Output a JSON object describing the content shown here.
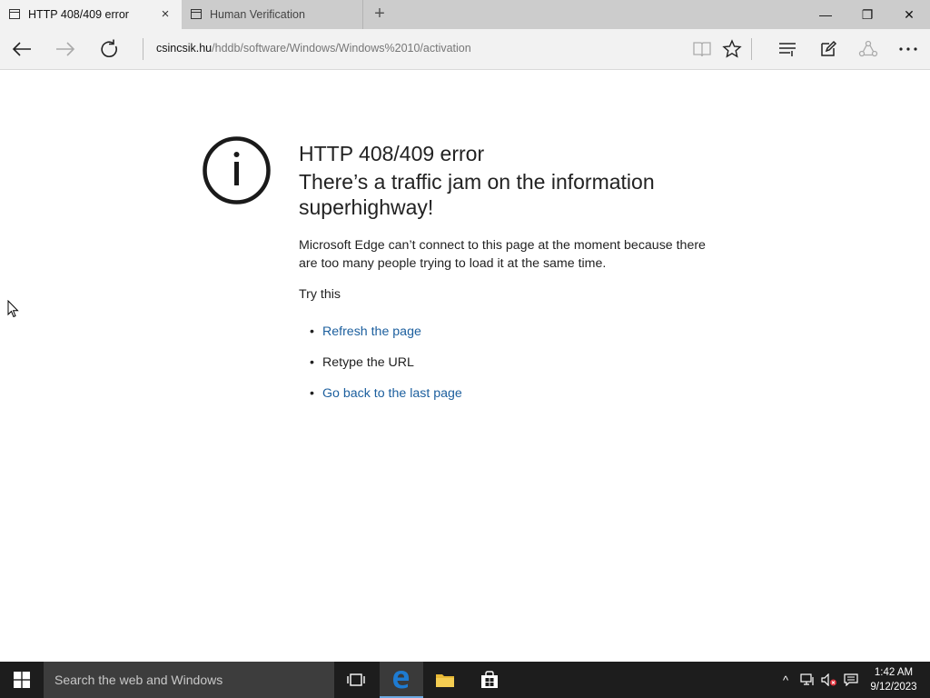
{
  "tabs": [
    {
      "title": "HTTP 408/409 error",
      "close_icon": "×"
    },
    {
      "title": "Human Verification"
    }
  ],
  "new_tab_icon": "+",
  "window_controls": {
    "minimize": "—",
    "restore": "❐",
    "close": "✕"
  },
  "address": {
    "host": "csincsik.hu",
    "path": "/hddb/software/Windows/Windows%2010/activation"
  },
  "toolbar_icons": [
    "back-icon",
    "forward-icon",
    "refresh-icon",
    "reading-view-icon",
    "favorite-star-icon",
    "hub-icon",
    "web-note-icon",
    "share-icon",
    "more-icon"
  ],
  "error": {
    "title": "HTTP 408/409 error",
    "subtitle": "There’s a traffic jam on the information superhighway!",
    "description": "Microsoft Edge can’t connect to this page at the moment because there are too many people trying to load it at the same time.",
    "try_label": "Try this",
    "suggestions": [
      {
        "text": "Refresh the page",
        "link": true
      },
      {
        "text": "Retype the URL",
        "link": false
      },
      {
        "text": "Go back to the last page",
        "link": true
      }
    ],
    "bullet": "•"
  },
  "taskbar": {
    "search_placeholder": "Search the web and Windows",
    "time": "1:42 AM",
    "date": "9/12/2023",
    "tray_chevron": "^"
  },
  "colors": {
    "link": "#1c5f9e",
    "tab_strip": "#cccccc",
    "toolbar": "#f2f2f2",
    "taskbar": "#1d1d1d",
    "edge_blue": "#1e7bd1"
  }
}
